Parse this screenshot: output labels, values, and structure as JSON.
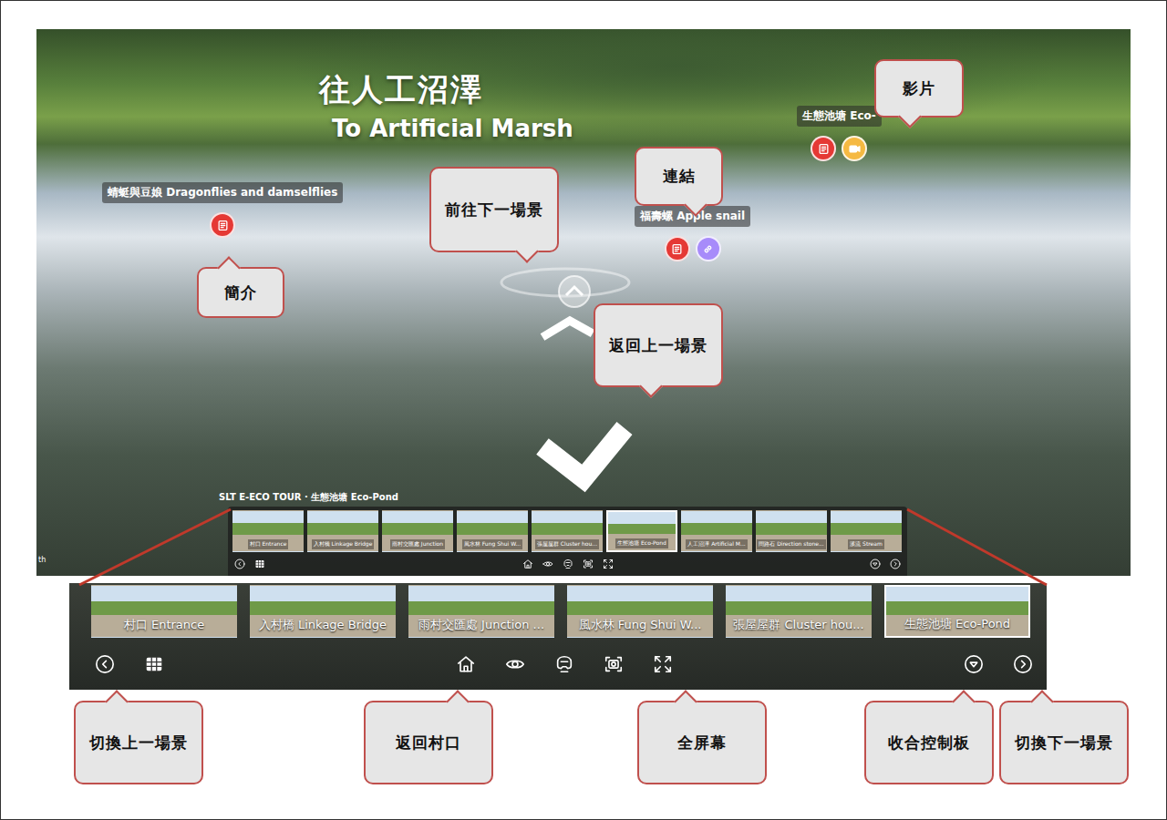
{
  "scene": {
    "title_zh": "往人工沼澤",
    "title_en": "To Artificial Marsh",
    "corner_text": "th"
  },
  "hotspots": [
    {
      "label": "蜻蜓與豆娘 Dragonflies and damselflies",
      "buttons": [
        {
          "kind": "info",
          "color": "#e53935"
        }
      ]
    },
    {
      "label": "福壽螺 Apple snail",
      "buttons": [
        {
          "kind": "info",
          "color": "#e53935"
        },
        {
          "kind": "link",
          "color": "#a78bfa"
        }
      ]
    },
    {
      "label": "生態池塘 Eco-",
      "buttons": [
        {
          "kind": "info",
          "color": "#e53935"
        },
        {
          "kind": "video",
          "color": "#f5b942"
        }
      ]
    }
  ],
  "tour_bar": {
    "title": "SLT E-ECO TOUR · 生態池塘 Eco-Pond",
    "scenes": [
      {
        "label": "村口 Entrance",
        "selected": false
      },
      {
        "label": "入村橋 Linkage Bridge",
        "selected": false
      },
      {
        "label": "雨村交匯處 Junction",
        "selected": false
      },
      {
        "label": "風水林 Fung Shui W...",
        "selected": false
      },
      {
        "label": "張屋屋群 Cluster hou...",
        "selected": false
      },
      {
        "label": "生態池塘 Eco-Pond",
        "selected": true
      },
      {
        "label": "人工沼澤 Artificial M...",
        "selected": false
      },
      {
        "label": "問路石 Direction stone...",
        "selected": false
      },
      {
        "label": "溪流 Stream",
        "selected": false
      }
    ]
  },
  "zoomed_bar": {
    "scenes": [
      {
        "label": "村口 Entrance",
        "selected": false
      },
      {
        "label": "入村橋 Linkage Bridge",
        "selected": false
      },
      {
        "label": "雨村交匯處 Junction ...",
        "selected": false
      },
      {
        "label": "風水林 Fung Shui W...",
        "selected": false
      },
      {
        "label": "張屋屋群 Cluster hou...",
        "selected": false
      },
      {
        "label": "生態池塘 Eco-Pond",
        "selected": true
      }
    ]
  },
  "callouts": [
    {
      "text": "影片"
    },
    {
      "text": "連結"
    },
    {
      "text": "前往下一場景"
    },
    {
      "text": "簡介"
    },
    {
      "text": "返回上一場景"
    },
    {
      "text": "切換上一場景"
    },
    {
      "text": "返回村口"
    },
    {
      "text": "全屏幕"
    },
    {
      "text": "收合控制板"
    },
    {
      "text": "切換下一場景"
    }
  ]
}
